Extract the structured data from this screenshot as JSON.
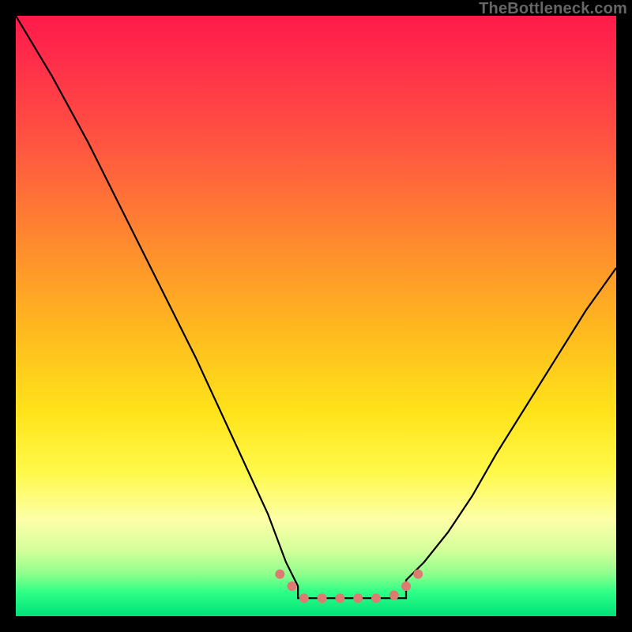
{
  "attribution": "TheBottleneck.com",
  "chart_data": {
    "type": "line",
    "title": "",
    "xlabel": "",
    "ylabel": "",
    "xlim": [
      0,
      100
    ],
    "ylim": [
      0,
      100
    ],
    "series": [
      {
        "name": "left-arm",
        "x": [
          0,
          6,
          12,
          18,
          24,
          30,
          36,
          42,
          45,
          47
        ],
        "y": [
          100,
          90,
          79,
          67,
          55,
          43,
          30,
          17,
          9,
          5
        ]
      },
      {
        "name": "right-arm",
        "x": [
          65,
          68,
          72,
          76,
          80,
          85,
          90,
          95,
          100
        ],
        "y": [
          6,
          9,
          14,
          20,
          27,
          35,
          43,
          51,
          58
        ]
      }
    ],
    "flat_bottom": {
      "x_start": 47,
      "x_end": 65,
      "y": 3,
      "markers_x": [
        44,
        46,
        48,
        51,
        54,
        57,
        60,
        63,
        65,
        67
      ],
      "markers_y": [
        7,
        5,
        3,
        3,
        3,
        3,
        3,
        3.5,
        5,
        7
      ],
      "marker_color": "#dd7b72",
      "marker_radius": 6
    }
  }
}
